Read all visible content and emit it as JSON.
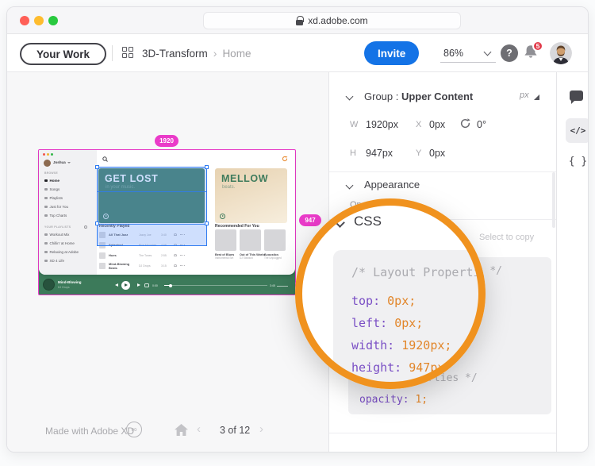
{
  "browser": {
    "url": "xd.adobe.com"
  },
  "toolbar": {
    "your_work": "Your Work",
    "project": "3D-Transform",
    "separator": "›",
    "page": "Home",
    "invite": "Invite",
    "zoom_level": "86%",
    "help": "?",
    "notification_count": "5"
  },
  "panel": {
    "group": {
      "label": "Group : ",
      "name": "Upper Content",
      "unit": "px",
      "w_label": "W",
      "w_value": "1920px",
      "x_label": "X",
      "x_value": "0px",
      "rotation_value": "0°",
      "h_label": "H",
      "h_value": "947px",
      "y_label": "Y",
      "y_value": "0px"
    },
    "appearance": {
      "title": "Appearance",
      "opacity_label": "Opacity"
    },
    "css": {
      "title": "CSS",
      "copy_hint": "Select to copy",
      "code_lines": [
        {
          "type": "comment",
          "text": "/* Layout Properties */"
        },
        {
          "type": "decl",
          "prop": "top",
          "value": "0px"
        },
        {
          "type": "decl",
          "prop": "left",
          "value": "0px"
        },
        {
          "type": "decl",
          "prop": "width",
          "value": "1920px"
        },
        {
          "type": "decl",
          "prop": "height",
          "value": "947px"
        },
        {
          "type": "comment",
          "text": "/* UI Properties */"
        },
        {
          "type": "decl",
          "prop": "opacity",
          "value": "1"
        }
      ]
    }
  },
  "rail": {
    "code_icon": "</>",
    "braces_icon": "{ }"
  },
  "canvas": {
    "artboard_width_label": "1920",
    "artboard_height_label": "947",
    "footer": {
      "made_with": "Made with Adobe XD",
      "prev": "‹",
      "page_indicator": "3 of 12",
      "next": "›"
    }
  },
  "design": {
    "user_name": "Joshua",
    "browse_label": "BROWSE",
    "nav_items": [
      "Home",
      "Songs",
      "Playlists",
      "Just for You",
      "Top Charts"
    ],
    "playlists_label": "YOUR PLAYLISTS",
    "playlist_items": [
      "Workout Mix",
      "Chillin' at Home",
      "Relaxing at Adobe",
      "XD 4 Life"
    ],
    "hero_title": "GET LOST",
    "hero_subtitle": "in your music.",
    "promo_title": "MELLOW",
    "promo_subtitle": "beats.",
    "recently_played_label": "Recently Played",
    "recent_tracks": [
      {
        "title": "All That Jazz",
        "artist": "Jazzy Joe",
        "duration": "3:40"
      },
      {
        "title": "Splashed",
        "artist": "Blue Mountain",
        "duration": "4:05"
      },
      {
        "title": "Hues",
        "artist": "The Tones",
        "duration": "2:55"
      },
      {
        "title": "Mind-Blowing Beats",
        "artist": "DJ Drops",
        "duration": "3:15"
      }
    ],
    "recommended_label": "Recommended For You",
    "albums": [
      {
        "title": "Best of Blues",
        "subtitle": "Instrumental Set"
      },
      {
        "title": "Out of This World",
        "subtitle": "DJ Stardust"
      },
      {
        "title": "Acoustics",
        "subtitle": "The Unplugged"
      }
    ],
    "player": {
      "track": "Mind-Blowing",
      "artist": "DJ Drops",
      "elapsed": "0:00",
      "total": "3:45"
    }
  },
  "colors": {
    "accent_blue": "#1473e6",
    "selection_magenta": "#ea3bc9",
    "selection_blue": "#2e7bf0",
    "magnifier_orange": "#f0921e",
    "design_green": "#3f7d5e",
    "code_property": "#7a4fc5",
    "code_value": "#e2862a"
  }
}
